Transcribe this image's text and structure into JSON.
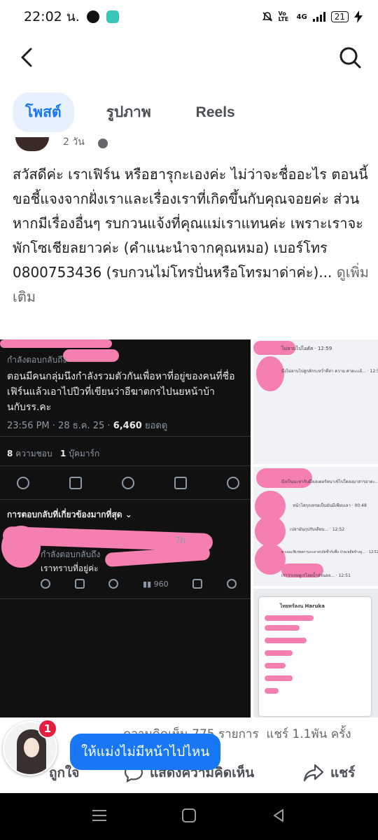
{
  "status": {
    "time": "22:02 น.",
    "network": "4G",
    "volte": "Vo LTE",
    "battery": "21"
  },
  "tabs": [
    {
      "label": "โพสต์",
      "active": true
    },
    {
      "label": "รูปภาพ",
      "active": false
    },
    {
      "label": "Reels",
      "active": false
    }
  ],
  "post_header": {
    "time": "2 วัน"
  },
  "post": {
    "text": "สวัสดีค่ะ เราเฟิร์น หรือฮารุกะเองค่ะ ไม่ว่าจะชื่ออะไร ตอนนี้ขอชี้แจงจากฝั่งเราและเรื่องเราที่เกิดขึ้นกับคุณจอยค่ะ ส่วนหากมีเรื่องอื่นๆ รบกวนแจ้งที่คุณแม่เราแทนค่ะ เพราะเราจะพักโซเชียลยาวค่ะ (คำแนะนำจากคุณหมอ) เบอร์โทร 0800753436 (รบกวนไม่โทรปั่นหรือโทรมาด่าค่ะ)...",
    "see_more": "ดูเพิ่มเติม"
  },
  "photo_main": {
    "reply_to": "กำลังตอบกลับถึง",
    "tweet": "ตอนมีคนกลุ่มนึงกำลังรวมตัวกันเพื่อหาที่อยู่ของคนที่ชื่อเฟิร์นแล้วเอาไปปีวที่เขียนว่าอีฆาตกรไปนยหน้าบ้านกับรร.คะ",
    "timestamp": "23:56 PM · 28 ธ.ค. 25 ·",
    "views": "6,460",
    "views_label": "ยอดดู",
    "likes_count": "8",
    "likes_label": "ความชอบ",
    "bookmarks_count": "1",
    "bookmarks_label": "บุ๊คมาร์ก",
    "relevant_label": "การตอบกลับที่เกี่ยวข้องมากที่สุด",
    "reply_time": "7h",
    "reply_label": "กำลังตอบกลับถึง",
    "reply_text": "เราทราบที่อยู่ค่ะ",
    "reply_views": "960"
  },
  "side1": {
    "line1": "ไม่ลาบไปไอดัส · 12:59",
    "line2": "มึงไม่ลาบไปสูกลักระหว่ำที่ล่า ความ ค่าตะเเล้... · 12:55"
  },
  "side2": {
    "line1": "มึงเป็นนะหากับมึงเลเตอร์หนาเข้ไปใตลงมาสารอาตะ... · 01:32",
    "line2": "หน้าโสกุกเหรอเป็นมันมีเพียบเลา · 00:48",
    "line3": "เปลามันกุปกับเดียน... · 12:52",
    "line4": "ทาเออะฟิเก่พอกานกะลาสรถัยซ้ำกับฟิ้ง ป่วยเหลียข้างลู... · 12:52",
    "line5": "เราว่าเรหดูเรโลยน้ำส่วนลล... · 12:51"
  },
  "side3": {
    "title": "ไทยหร์ลงน Haruka"
  },
  "bottom": {
    "comments_count": "ความคิดเห็น 775 รายการ",
    "shares_count": "แชร์ 1.1พัน ครั้ง",
    "like_label": "ถูกใจ",
    "comment_label": "แสดงความคิดเห็น",
    "share_label": "แชร์"
  },
  "chathead": {
    "badge": "1",
    "bubble": "ให้แม่งไม่มีหน้าไปไหน"
  },
  "colors": {
    "accent": "#1877f2",
    "redaction": "#f47fb0",
    "badge": "#e41e3f"
  }
}
